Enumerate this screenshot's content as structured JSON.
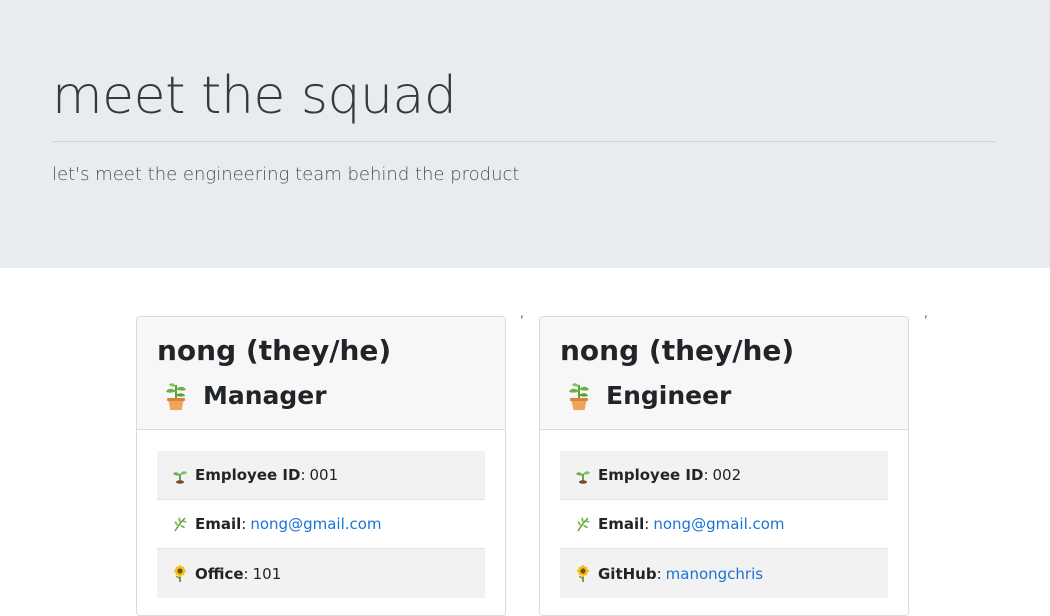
{
  "header": {
    "title": "meet the squad",
    "lead": "let's meet the engineering team behind the product"
  },
  "stray_marks": [
    ",",
    ","
  ],
  "colors": {
    "jumbotron_bg": "#e9ecef",
    "card_header_bg": "#f7f7f7",
    "link": "#1a73d9",
    "shaded_row": "#f2f2f2"
  },
  "cards": [
    {
      "name": "nong (they/he)",
      "role_icon": "potted-plant-icon",
      "role": "Manager",
      "items": [
        {
          "icon": "seedling-icon",
          "label": "Employee ID",
          "sep": ":",
          "value": "001",
          "link": false
        },
        {
          "icon": "herb-icon",
          "label": "Email",
          "sep": ":",
          "value": "nong@gmail.com",
          "link": true
        },
        {
          "icon": "sunflower-icon",
          "label": "Office",
          "sep": ":",
          "value": "101",
          "link": false
        }
      ]
    },
    {
      "name": "nong (they/he)",
      "role_icon": "potted-plant-icon",
      "role": "Engineer",
      "items": [
        {
          "icon": "seedling-icon",
          "label": "Employee ID",
          "sep": ":",
          "value": "002",
          "link": false
        },
        {
          "icon": "herb-icon",
          "label": "Email",
          "sep": ":",
          "value": "nong@gmail.com",
          "link": true
        },
        {
          "icon": "sunflower-icon",
          "label": "GitHub",
          "sep": ":",
          "value": "manongchris",
          "link": true
        }
      ]
    }
  ]
}
